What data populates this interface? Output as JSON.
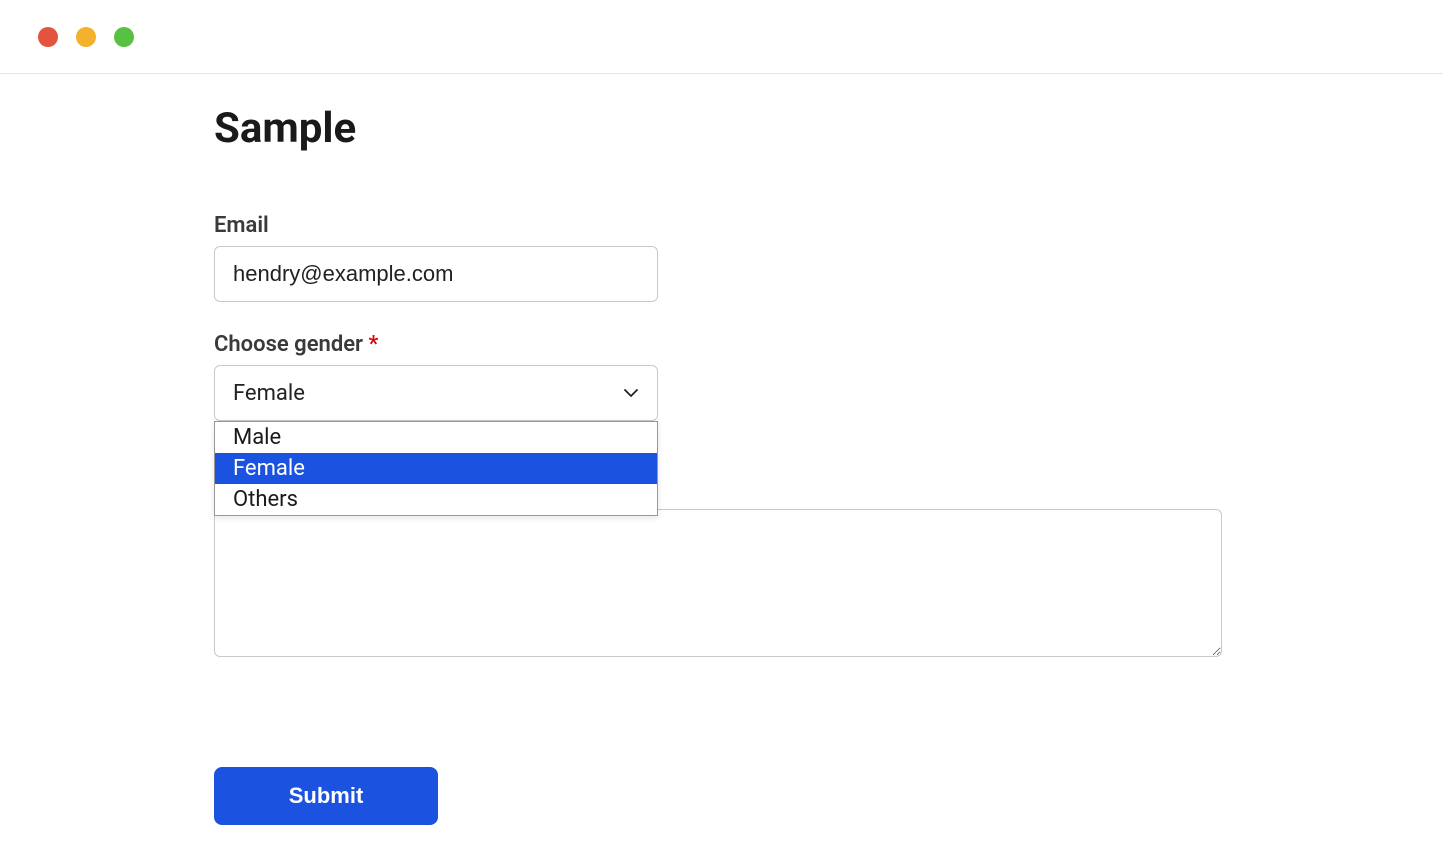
{
  "window": {
    "traffic_lights": [
      "close",
      "minimize",
      "maximize"
    ]
  },
  "form": {
    "title": "Sample",
    "email": {
      "label": "Email",
      "value": "hendry@example.com"
    },
    "gender": {
      "label": "Choose gender",
      "required_mark": "*",
      "selected": "Female",
      "options": [
        "Male",
        "Female",
        "Others"
      ],
      "highlighted_index": 1
    },
    "comments": {
      "value": ""
    },
    "submit_label": "Submit"
  }
}
